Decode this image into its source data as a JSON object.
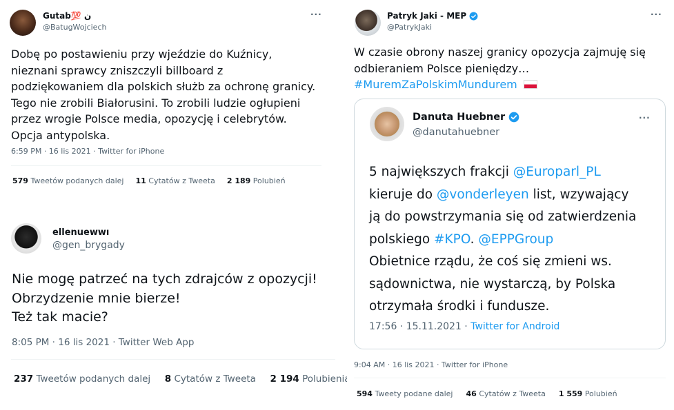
{
  "tweet1": {
    "name": "Gutab💯 ن",
    "handle": "@BatugWojciech",
    "more": "···",
    "text_lines": [
      "Dobę po postawieniu przy wjeździe do Kuźnicy,",
      "nieznani sprawcy zniszczyli  billboard z",
      "podziękowaniem dla polskich służb za ochronę granicy.",
      "Tego nie zrobili Białorusini. To zrobili ludzie ogłupieni",
      "przez wrogie Polsce media, opozycję i celebrytów.",
      "Opcja antypolska."
    ],
    "meta": "6:59 PM · 16 lis 2021 · Twitter for iPhone",
    "retweets_count": "579",
    "retweets_label": "Tweetów podanych dalej",
    "quotes_count": "11",
    "quotes_label": "Cytatów z Tweeta",
    "likes_count": "2 189",
    "likes_label": "Polubień"
  },
  "tweet2": {
    "name": "ellenuewwı",
    "handle": "@gen_brygady",
    "text_lines": [
      "Nie mogę patrzeć na tych zdrajców z opozycji!",
      "Obrzydzenie mnie bierze!",
      "Też tak macie?"
    ],
    "meta": "8:05 PM · 16 lis 2021 · Twitter Web App",
    "retweets_count": "237",
    "retweets_label": "Tweetów podanych dalej",
    "quotes_count": "8",
    "quotes_label": "Cytatów z Tweeta",
    "likes_count": "2 194",
    "likes_label": "Polubienia"
  },
  "tweet3": {
    "name": "Patryk Jaki - MEP",
    "handle": "@PatrykJaki",
    "more": "···",
    "text_line1": "W czasie obrony naszej granicy opozycja zajmuję się",
    "text_line2": "odbieraniem Polsce pieniędzy…",
    "hashtag": "#MuremZaPolskimMundurem",
    "meta": "9:04 AM · 16 lis 2021 · Twitter for iPhone",
    "retweets_count": "594",
    "retweets_label": "Tweety podane dalej",
    "quotes_count": "46",
    "quotes_label": "Cytatów z Tweeta",
    "likes_count": "1 559",
    "likes_label": "Polubień",
    "quote": {
      "name": "Danuta Huebner",
      "handle": "@danutahuebner",
      "more": "···",
      "l1_a": "5 największych frakcji ",
      "l1_link": "@Europarl_PL",
      "l2_a": "kieruje do ",
      "l2_link": "@vonderleyen",
      "l2_b": " list, wzywający",
      "l3": "ją do powstrzymania się od zatwierdzenia",
      "l4_a": "polskiego ",
      "l4_link1": "#KPO",
      "l4_b": ". ",
      "l4_link2": "@EPPGroup",
      "l5": "Obietnice rządu, że coś się zmieni ws.",
      "l6": "sądownictwa, nie wystarczą, by Polska",
      "l7": "otrzymała środki i fundusze.",
      "meta_time": "17:56 · 15.11.2021 · ",
      "meta_link": "Twitter for Android"
    }
  },
  "colors": {
    "accent": "#1d9bf0",
    "text": "#0f1419",
    "muted": "#536471",
    "border": "#cfd9de"
  }
}
